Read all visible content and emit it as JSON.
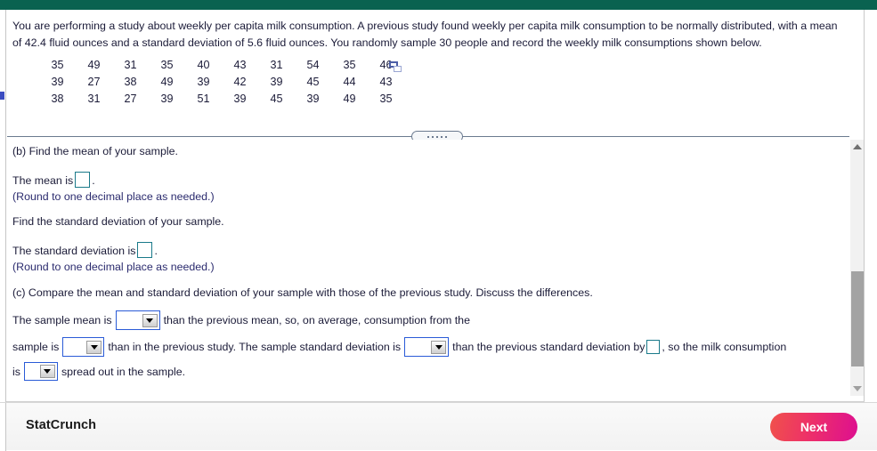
{
  "header": {
    "accent_color": "#0a6250"
  },
  "problem": {
    "statement": "You are performing a study about weekly per capita milk consumption. A previous study found weekly per capita milk consumption to be normally distributed, with a mean of 42.4 fluid ounces and a standard deviation of 5.6 fluid ounces. You randomly sample 30 people and record the weekly milk consumptions shown below.",
    "sample_size": 30,
    "population_mean": 42.4,
    "population_sd": 5.6,
    "data_rows": [
      [
        "35",
        "49",
        "31",
        "35",
        "40",
        "43",
        "31",
        "54",
        "35",
        "46"
      ],
      [
        "39",
        "27",
        "38",
        "49",
        "39",
        "42",
        "39",
        "45",
        "44",
        "43"
      ],
      [
        "38",
        "31",
        "27",
        "39",
        "51",
        "39",
        "45",
        "39",
        "49",
        "35"
      ]
    ],
    "popout_icon": "popout-table-icon"
  },
  "parts": {
    "b_prompt": "(b) Find the mean of your sample.",
    "mean_pre": "The mean is",
    "mean_post": ".",
    "mean_value": "",
    "mean_note": "(Round to one decimal place as needed.)",
    "sd_prompt": "Find the standard deviation of your sample.",
    "sd_pre": "The standard deviation is",
    "sd_post": ".",
    "sd_value": "",
    "sd_note": "(Round to one decimal place as needed.)",
    "c_prompt": "(c) Compare the mean and standard deviation of your sample with those of the previous study. Discuss the differences.",
    "cmp_1_pre": "The sample mean is",
    "cmp_1_mid": "than the previous mean, so, on average, consumption from the",
    "cmp_2_pre": "sample is",
    "cmp_2_mid": "than in the previous study. The sample standard deviation is",
    "cmp_2_post": "than the previous standard deviation by",
    "cmp_2_tail": ", so the milk consumption",
    "cmp_3_pre": "is",
    "cmp_3_post": "spread out in the sample.",
    "dropdown_1_value": "",
    "dropdown_2_value": "",
    "dropdown_3_value": "",
    "dropdown_4_value": "",
    "sd_diff_value": ""
  },
  "splitter": {
    "dots": 5
  },
  "scrollbar": {
    "up_arrow_icon": "triangle-up-icon",
    "down_arrow_icon": "triangle-down-icon"
  },
  "footer": {
    "statcrunch_label": "StatCrunch",
    "next_label": "Next",
    "next_gradient_start": "#f0514b",
    "next_gradient_end": "#dd0f90"
  }
}
